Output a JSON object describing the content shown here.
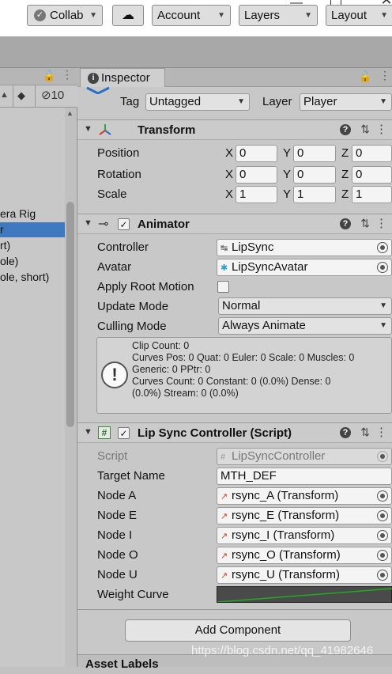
{
  "toolbar": {
    "collab": "Collab",
    "account": "Account",
    "layers": "Layers",
    "layout": "Layout"
  },
  "hierarchy": {
    "count": "10",
    "items": [
      "era Rig",
      "r",
      "rt)",
      "ole)",
      "ole, short)"
    ],
    "selected_index": 1
  },
  "inspector": {
    "tab": "Inspector",
    "tag_label": "Tag",
    "tag_value": "Untagged",
    "layer_label": "Layer",
    "layer_value": "Player",
    "transform": {
      "title": "Transform",
      "rows": [
        {
          "label": "Position",
          "x": "0",
          "y": "0",
          "z": "0"
        },
        {
          "label": "Rotation",
          "x": "0",
          "y": "0",
          "z": "0"
        },
        {
          "label": "Scale",
          "x": "1",
          "y": "1",
          "z": "1"
        }
      ],
      "axis_x": "X",
      "axis_y": "Y",
      "axis_z": "Z"
    },
    "animator": {
      "title": "Animator",
      "controller_label": "Controller",
      "controller_value": "LipSync",
      "avatar_label": "Avatar",
      "avatar_value": "LipSyncAvatar",
      "root_motion_label": "Apply Root Motion",
      "update_mode_label": "Update Mode",
      "update_mode_value": "Normal",
      "culling_mode_label": "Culling Mode",
      "culling_mode_value": "Always Animate",
      "info": "Clip Count: 0\nCurves Pos: 0 Quat: 0 Euler: 0 Scale: 0 Muscles: 0\nGeneric: 0 PPtr: 0\nCurves Count: 0 Constant: 0 (0.0%) Dense: 0\n(0.0%) Stream: 0 (0.0%)"
    },
    "lipsync": {
      "title": "Lip Sync Controller (Script)",
      "script_label": "Script",
      "script_value": "LipSyncController",
      "target_label": "Target Name",
      "target_value": "MTH_DEF",
      "nodes": [
        {
          "label": "Node A",
          "value": "rsync_A (Transform)"
        },
        {
          "label": "Node E",
          "value": "rsync_E (Transform)"
        },
        {
          "label": "Node I",
          "value": "rsync_I (Transform)"
        },
        {
          "label": "Node O",
          "value": "rsync_O (Transform)"
        },
        {
          "label": "Node U",
          "value": "rsync_U (Transform)"
        }
      ],
      "curve_label": "Weight Curve"
    },
    "add_component": "Add Component",
    "asset_labels": "Asset Labels"
  },
  "watermark": "https://blog.csdn.net/qq_41982646",
  "colors": {
    "selection": "#3f78bf",
    "curve": "#22aa22"
  }
}
